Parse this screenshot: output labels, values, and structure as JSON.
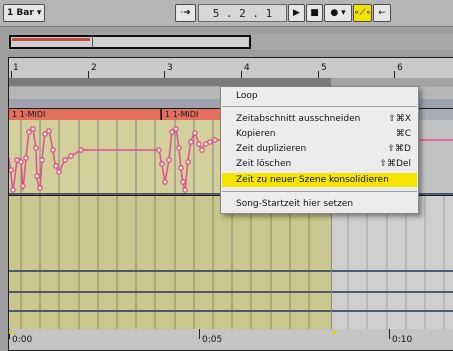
{
  "transport": {
    "quantize_label": "1 Bar ▾",
    "follow_icon": "·➜",
    "position_display": "5 .  2 .  1",
    "play_icon": "▶",
    "stop_icon": "■",
    "record_icon": "● ▾",
    "draw_mode_icon": "∘⟋∘",
    "back_icon": "←"
  },
  "ruler": {
    "bar_numbers": [
      "1",
      "2",
      "3",
      "4",
      "5",
      "6"
    ]
  },
  "clips": [
    {
      "title": "1 1-MIDI"
    },
    {
      "title": "1 1-MIDI"
    }
  ],
  "timeline": {
    "time_labels": [
      "0:00",
      "0:05",
      "0:10"
    ]
  },
  "context_menu": {
    "items": [
      {
        "label": "Loop",
        "shortcut": ""
      },
      {
        "label": "Zeitabschnitt ausschneiden",
        "shortcut": "⇧⌘X"
      },
      {
        "label": "Kopieren",
        "shortcut": "⌘C"
      },
      {
        "label": "Zeit duplizieren",
        "shortcut": "⇧⌘D"
      },
      {
        "label": "Zeit löschen",
        "shortcut": "⇧⌘Del"
      },
      {
        "label": "Zeit zu neuer Szene konsolidieren",
        "shortcut": ""
      },
      {
        "label": "Song-Startzeit hier setzen",
        "shortcut": ""
      }
    ]
  },
  "colors": {
    "highlight": "#f5e400",
    "clip_header": "#e26f5e",
    "automation": "#e0508c"
  }
}
